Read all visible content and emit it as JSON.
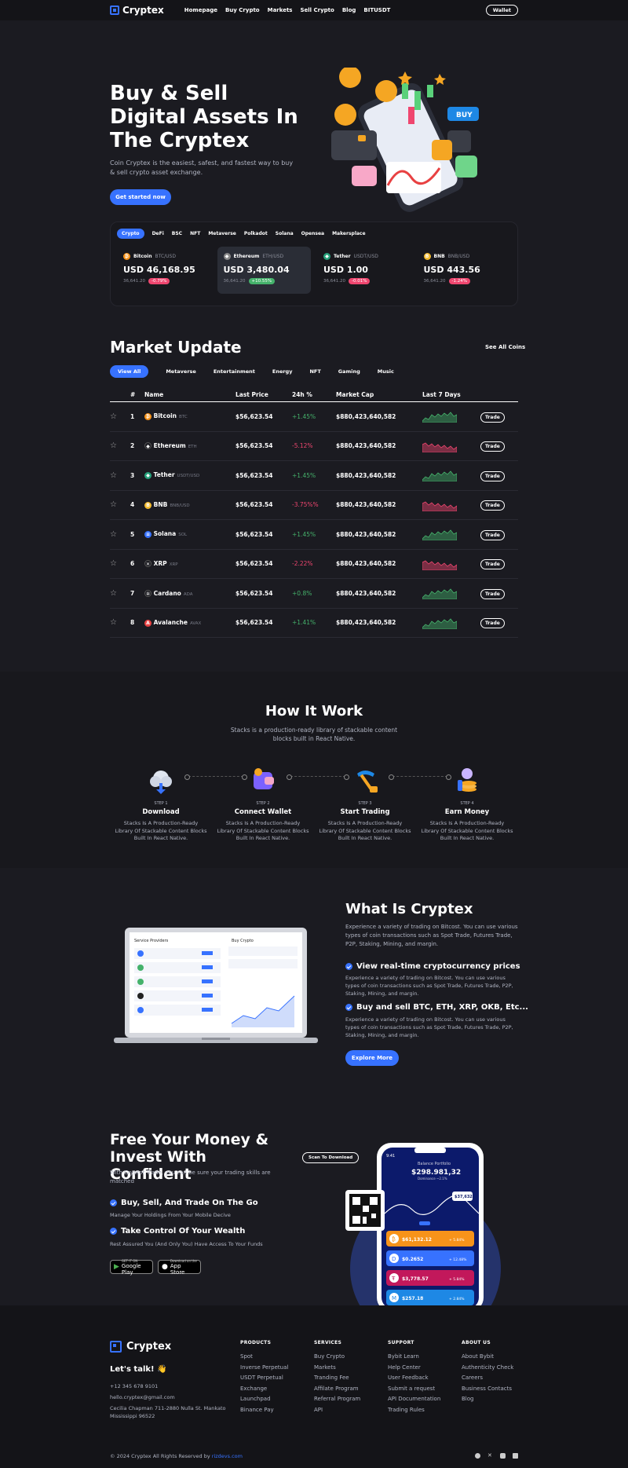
{
  "brand": "Cryptex",
  "nav": {
    "items": [
      "Homepage",
      "Buy Crypto",
      "Markets",
      "Sell Crypto",
      "Blog",
      "BITUSDT"
    ],
    "wallet": "Wallet"
  },
  "hero": {
    "title": "Buy & Sell Digital Assets In The Cryptex",
    "desc": "Coin Cryptex is the easiest, safest, and fastest way to buy & sell crypto asset exchange.",
    "cta": "Get started now"
  },
  "coin_tabs": {
    "tabs": [
      "Crypto",
      "DeFi",
      "BSC",
      "NFT",
      "Metaverse",
      "Polkadot",
      "Solana",
      "Opensea",
      "Makersplace"
    ],
    "tickers": [
      {
        "name": "Bitcoin",
        "pair": "BTC/USD",
        "price": "USD 46,168.95",
        "vol": "36,641.20",
        "change": "-0.79%",
        "color": "#f7931a",
        "glyph": "₿",
        "tone": "red"
      },
      {
        "name": "Ethereum",
        "pair": "ETH/USD",
        "price": "USD 3,480.04",
        "vol": "36,641.20",
        "change": "+10.55%",
        "color": "#888",
        "glyph": "◆",
        "tone": "grn"
      },
      {
        "name": "Tether",
        "pair": "USDT/USD",
        "price": "USD 1.00",
        "vol": "36,641.20",
        "change": "-0.01%",
        "color": "#26a17b",
        "glyph": "◆",
        "tone": "red"
      },
      {
        "name": "BNB",
        "pair": "BNB/USD",
        "price": "USD 443.56",
        "vol": "36,641.20",
        "change": "-1.24%",
        "color": "#f3ba2f",
        "glyph": "B",
        "tone": "red"
      }
    ]
  },
  "market": {
    "title": "Market Update",
    "see_all": "See All Coins",
    "tabs": [
      "View All",
      "Metaverse",
      "Entertainment",
      "Energy",
      "NFT",
      "Gaming",
      "Music"
    ],
    "headers": [
      "#",
      "Name",
      "Last Price",
      "24h %",
      "Market Cap",
      "Last 7 Days"
    ],
    "trade_label": "Trade",
    "rows": [
      {
        "n": "1",
        "name": "Bitcoin",
        "sym": "BTC",
        "price": "$56,623.54",
        "chg": "+1.45%",
        "cap": "$880,423,640,582",
        "dir": "up",
        "color": "#f7931a",
        "glyph": "₿"
      },
      {
        "n": "2",
        "name": "Ethereum",
        "sym": "ETH",
        "price": "$56,623.54",
        "chg": "-5.12%",
        "cap": "$880,423,640,582",
        "dir": "dn",
        "color": "#1b1b21",
        "glyph": "◆"
      },
      {
        "n": "3",
        "name": "Tether",
        "sym": "USDT/USD",
        "price": "$56,623.54",
        "chg": "+1.45%",
        "cap": "$880,423,640,582",
        "dir": "up",
        "color": "#26a17b",
        "glyph": "◆"
      },
      {
        "n": "4",
        "name": "BNB",
        "sym": "BNB/USD",
        "price": "$56,623.54",
        "chg": "-3.75%%",
        "cap": "$880,423,640,582",
        "dir": "dn",
        "color": "#f3ba2f",
        "glyph": "B"
      },
      {
        "n": "5",
        "name": "Solana",
        "sym": "SOL",
        "price": "$56,623.54",
        "chg": "+1.45%",
        "cap": "$880,423,640,582",
        "dir": "up",
        "color": "#3772ff",
        "glyph": "≡"
      },
      {
        "n": "6",
        "name": "XRP",
        "sym": "XRP",
        "price": "$56,623.54",
        "chg": "-2.22%",
        "cap": "$880,423,640,582",
        "dir": "dn",
        "color": "#1b1b21",
        "glyph": "✕"
      },
      {
        "n": "7",
        "name": "Cardano",
        "sym": "ADA",
        "price": "$56,623.54",
        "chg": "+0.8%",
        "cap": "$880,423,640,582",
        "dir": "up",
        "color": "#1b1b21",
        "glyph": "✲"
      },
      {
        "n": "8",
        "name": "Avalanche",
        "sym": "AVAX",
        "price": "$56,623.54",
        "chg": "+1.41%",
        "cap": "$880,423,640,582",
        "dir": "up",
        "color": "#e84142",
        "glyph": "A"
      }
    ]
  },
  "how": {
    "title": "How It Work",
    "desc": "Stacks is a production-ready library of stackable content blocks built in React Native.",
    "steps": [
      {
        "label": "STEP 1",
        "title": "Download",
        "desc": "Stacks Is A Production-Ready Library Of Stackable Content Blocks Built In React Native."
      },
      {
        "label": "STEP 2",
        "title": "Connect Wallet",
        "desc": "Stacks Is A Production-Ready Library Of Stackable Content Blocks Built In React Native."
      },
      {
        "label": "STEP 3",
        "title": "Start Trading",
        "desc": "Stacks Is A Production-Ready Library Of Stackable Content Blocks Built In React Native."
      },
      {
        "label": "STEP 4",
        "title": "Earn Money",
        "desc": "Stacks Is A Production-Ready Library Of Stackable Content Blocks Built In React Native."
      }
    ]
  },
  "what": {
    "title": "What Is Cryptex",
    "desc": "Experience a variety of trading on Bitcost. You can use various types of coin transactions such as Spot Trade, Futures Trade, P2P, Staking, Mining, and margin.",
    "f1": "View real-time cryptocurrency prices",
    "f1_desc": "Experience a variety of trading on Bitcost. You can use various types of coin transactions such as Spot Trade, Futures Trade, P2P, Staking, Mining, and margin.",
    "f2": "Buy and sell BTC, ETH, XRP, OKB, Etc...",
    "f2_desc": "Experience a variety of trading on Bitcost. You can use various types of coin transactions such as Spot Trade, Futures Trade, P2P, Staking, Mining, and margin.",
    "cta": "Explore More",
    "laptop_title": "Service Providers",
    "laptop_buy": "Buy Crypto"
  },
  "free": {
    "title": "Free Your Money & Invest With Confident",
    "desc": "With Cryptor Trade, you can be sure your trading skills are matched",
    "f1": "Buy, Sell, And Trade On The Go",
    "f1_desc": "Manage Your Holdings From Your Mobile Decive",
    "f2": "Take Control Of Your Wealth",
    "f2_desc": "Rest Assured You (And Only You) Have Access To Your Funds",
    "gp_small": "GET IT ON",
    "gp": "Google Play",
    "as_small": "Download on the",
    "as": "App Store",
    "scan": "Scan To Download",
    "phone": {
      "time": "9:41",
      "bal_label": "Balance Portfolio",
      "bal": "$298.981,32",
      "bal_sub": "Dominance ~2.1%",
      "tip": "$37,632",
      "coins": [
        {
          "v": "$61,132.12",
          "c": "+ 5.84%",
          "bg": "#f7931a",
          "g": "₿"
        },
        {
          "v": "$0.2652",
          "c": "+ 12.48%",
          "bg": "#3772ff",
          "g": "D"
        },
        {
          "v": "$3,778.57",
          "c": "+ 5.84%",
          "bg": "#c2185b",
          "g": "Ŧ"
        },
        {
          "v": "$257.18",
          "c": "+ 2.84%",
          "bg": "#1e88e5",
          "g": "M"
        }
      ]
    }
  },
  "footer": {
    "talk": "Let's talk! 👋",
    "phone": "+12 345 678 9101",
    "email": "hello.cryptex@gmail.com",
    "address": "Cecilia Chapman 711-2880 Nulla St. Mankato Mississippi 96522",
    "cols": [
      {
        "h": "PRODUCTS",
        "items": [
          "Spot",
          "Inverse Perpetual",
          "USDT Perpetual",
          "Exchange",
          "Launchpad",
          "Binance Pay"
        ]
      },
      {
        "h": "SERVICES",
        "items": [
          "Buy Crypto",
          "Markets",
          "Tranding Fee",
          "Affilate Program",
          "Referral Program",
          "API"
        ]
      },
      {
        "h": "SUPPORT",
        "items": [
          "Bybit Learn",
          "Help Center",
          "User Feedback",
          "Submit a request",
          "API Documentation",
          "Trading Rules"
        ]
      },
      {
        "h": "ABOUT US",
        "items": [
          "About Bybit",
          "Authenticity Check",
          "Careers",
          "Business Contacts",
          "Blog"
        ]
      }
    ],
    "copyright": "© 2024 Cryptex All Rights Reserved by ",
    "credit": "rizdevs.com"
  }
}
